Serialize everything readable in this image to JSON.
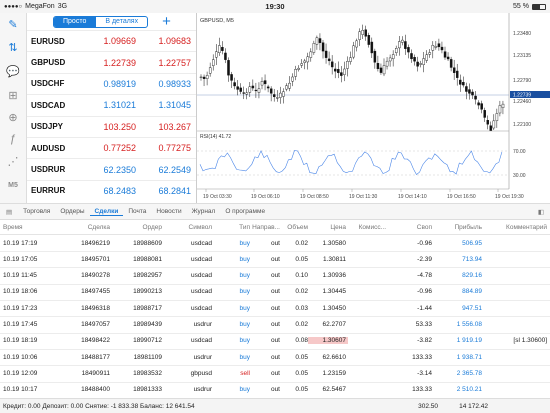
{
  "status": {
    "carrier": "MegaFon",
    "network": "3G",
    "time": "19:30",
    "battery": "55 %"
  },
  "toolbar": {
    "simple_label": "Просто",
    "detailed_label": "В деталях"
  },
  "quotes": [
    {
      "symbol": "EURUSD",
      "bid": "1.09669",
      "ask": "1.09683",
      "color": "red"
    },
    {
      "symbol": "GBPUSD",
      "bid": "1.22739",
      "ask": "1.22757",
      "color": "red"
    },
    {
      "symbol": "USDCHF",
      "bid": "0.98919",
      "ask": "0.98933",
      "color": "blue"
    },
    {
      "symbol": "USDCAD",
      "bid": "1.31021",
      "ask": "1.31045",
      "color": "blue"
    },
    {
      "symbol": "USDJPY",
      "bid": "103.250",
      "ask": "103.267",
      "color": "red"
    },
    {
      "symbol": "AUDUSD",
      "bid": "0.77252",
      "ask": "0.77275",
      "color": "red"
    },
    {
      "symbol": "USDRUR",
      "bid": "62.2350",
      "ask": "62.2549",
      "color": "blue"
    },
    {
      "symbol": "EURRUR",
      "bid": "68.2483",
      "ask": "68.2841",
      "color": "blue"
    }
  ],
  "chart": {
    "title": "GBPUSD, M5",
    "price_labels": [
      "1.23480",
      "1.23135",
      "1.22790",
      "1.22460",
      "1.22100"
    ],
    "current_price": "1.22739",
    "rsi_label": "RSI(14) 41.72",
    "rsi_levels": [
      "70.00",
      "30.00"
    ],
    "time_labels": [
      "19 Oct 03:30",
      "19 Oct 06:10",
      "19 Oct 08:50",
      "19 Oct 11:30",
      "19 Oct 14:10",
      "19 Oct 16:50",
      "19 Oct 19:30"
    ]
  },
  "tabs": [
    "Торговля",
    "Ордеры",
    "Сделки",
    "Почта",
    "Новости",
    "Журнал",
    "О программе"
  ],
  "active_tab": "Сделки",
  "table": {
    "headers": [
      "Время",
      "Сделка",
      "Ордер",
      "Символ",
      "Тип",
      "Направ...",
      "Объем",
      "Цена",
      "Комисс...",
      "Своп",
      "Прибыль",
      "Комментарий"
    ],
    "rows": [
      {
        "time": "10.19 17:19",
        "deal": "18496219",
        "order": "18988609",
        "symbol": "usdcad",
        "type": "buy",
        "dir": "out",
        "volume": "0.02",
        "price": "1.30580",
        "comm": "",
        "swap": "-0.96",
        "profit": "506.95",
        "comment": ""
      },
      {
        "time": "10.19 17:05",
        "deal": "18495701",
        "order": "18988081",
        "symbol": "usdcad",
        "type": "buy",
        "dir": "out",
        "volume": "0.05",
        "price": "1.30811",
        "comm": "",
        "swap": "-2.39",
        "profit": "713.94",
        "comment": ""
      },
      {
        "time": "10.19 11:45",
        "deal": "18490278",
        "order": "18982957",
        "symbol": "usdcad",
        "type": "buy",
        "dir": "out",
        "volume": "0.10",
        "price": "1.30936",
        "comm": "",
        "swap": "-4.78",
        "profit": "829.16",
        "comment": ""
      },
      {
        "time": "10.19 18:06",
        "deal": "18497455",
        "order": "18990213",
        "symbol": "usdcad",
        "type": "buy",
        "dir": "out",
        "volume": "0.02",
        "price": "1.30445",
        "comm": "",
        "swap": "-0.96",
        "profit": "884.89",
        "comment": ""
      },
      {
        "time": "10.19 17:23",
        "deal": "18496318",
        "order": "18988717",
        "symbol": "usdcad",
        "type": "buy",
        "dir": "out",
        "volume": "0.03",
        "price": "1.30450",
        "comm": "",
        "swap": "-1.44",
        "profit": "947.51",
        "comment": ""
      },
      {
        "time": "10.19 17:45",
        "deal": "18497057",
        "order": "18989439",
        "symbol": "usdrur",
        "type": "buy",
        "dir": "out",
        "volume": "0.02",
        "price": "62.2707",
        "comm": "",
        "swap": "53.33",
        "profit": "1 556.08",
        "comment": ""
      },
      {
        "time": "10.19 18:19",
        "deal": "18498422",
        "order": "18990712",
        "symbol": "usdcad",
        "type": "buy",
        "dir": "out",
        "volume": "0.08",
        "price": "1.30607",
        "comm": "",
        "swap": "-3.82",
        "profit": "1 919.19",
        "comment": "[sl 1.30600]",
        "highlight": true
      },
      {
        "time": "10.19 10:06",
        "deal": "18488177",
        "order": "18981109",
        "symbol": "usdrur",
        "type": "buy",
        "dir": "out",
        "volume": "0.05",
        "price": "62.6610",
        "comm": "",
        "swap": "133.33",
        "profit": "1 938.71",
        "comment": ""
      },
      {
        "time": "10.19 12:09",
        "deal": "18490911",
        "order": "18983532",
        "symbol": "gbpusd",
        "type": "sell",
        "dir": "out",
        "volume": "0.05",
        "price": "1.23159",
        "comm": "",
        "swap": "-3.14",
        "profit": "2 365.78",
        "comment": ""
      },
      {
        "time": "10.19 10:17",
        "deal": "18488400",
        "order": "18981333",
        "symbol": "usdrur",
        "type": "buy",
        "dir": "out",
        "volume": "0.05",
        "price": "62.5467",
        "comm": "",
        "swap": "133.33",
        "profit": "2 510.21",
        "comment": ""
      }
    ]
  },
  "footer": {
    "summary": "Кредит: 0.00 Депозит: 0.00 Снятие: -1 833.38 Баланс: 12 641.54",
    "swap_total": "302.50",
    "profit_total": "14 172.42"
  }
}
